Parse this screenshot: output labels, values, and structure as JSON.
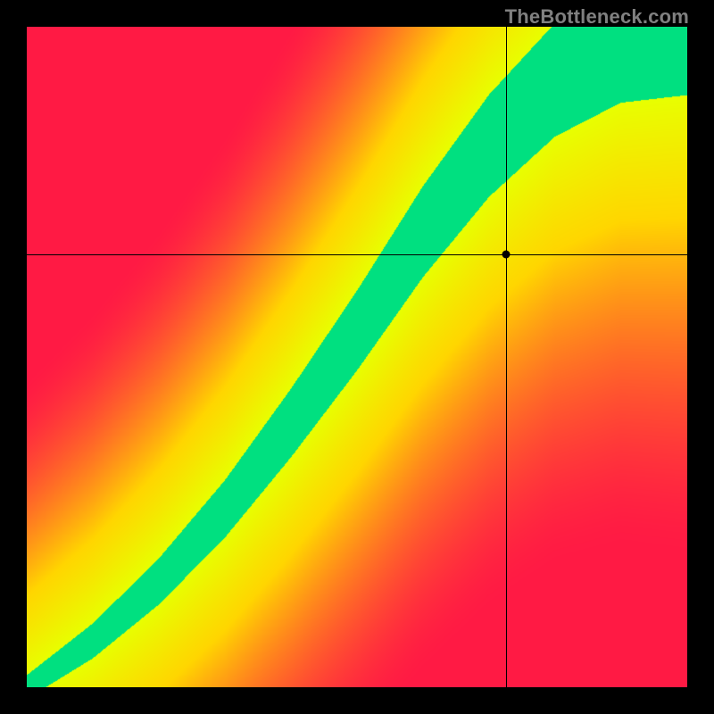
{
  "watermark": "TheBottleneck.com",
  "chart_data": {
    "type": "heatmap",
    "title": "",
    "xlabel": "",
    "ylabel": "",
    "xlim": [
      0,
      1
    ],
    "ylim": [
      0,
      1
    ],
    "grid": false,
    "legend": false,
    "color_scale": {
      "stops": [
        {
          "t": 0.0,
          "color": "#ff1a44"
        },
        {
          "t": 0.5,
          "color": "#ffd600"
        },
        {
          "t": 0.82,
          "color": "#e8ff00"
        },
        {
          "t": 1.0,
          "color": "#00e080"
        }
      ],
      "meaning": "bottleneck severity; green = balanced, red = severe bottleneck"
    },
    "ideal_path": {
      "description": "green ridge where components are balanced; slightly superlinear S-curve from origin",
      "points": [
        {
          "x": 0.0,
          "y": 0.0
        },
        {
          "x": 0.1,
          "y": 0.07
        },
        {
          "x": 0.2,
          "y": 0.16
        },
        {
          "x": 0.3,
          "y": 0.27
        },
        {
          "x": 0.4,
          "y": 0.4
        },
        {
          "x": 0.5,
          "y": 0.54
        },
        {
          "x": 0.6,
          "y": 0.69
        },
        {
          "x": 0.7,
          "y": 0.82
        },
        {
          "x": 0.8,
          "y": 0.92
        },
        {
          "x": 0.9,
          "y": 0.98
        },
        {
          "x": 1.0,
          "y": 1.0
        }
      ]
    },
    "marker": {
      "x": 0.725,
      "y": 0.655,
      "label": ""
    },
    "annotations": []
  },
  "colors": {
    "frame": "#000000",
    "watermark": "#808080"
  }
}
